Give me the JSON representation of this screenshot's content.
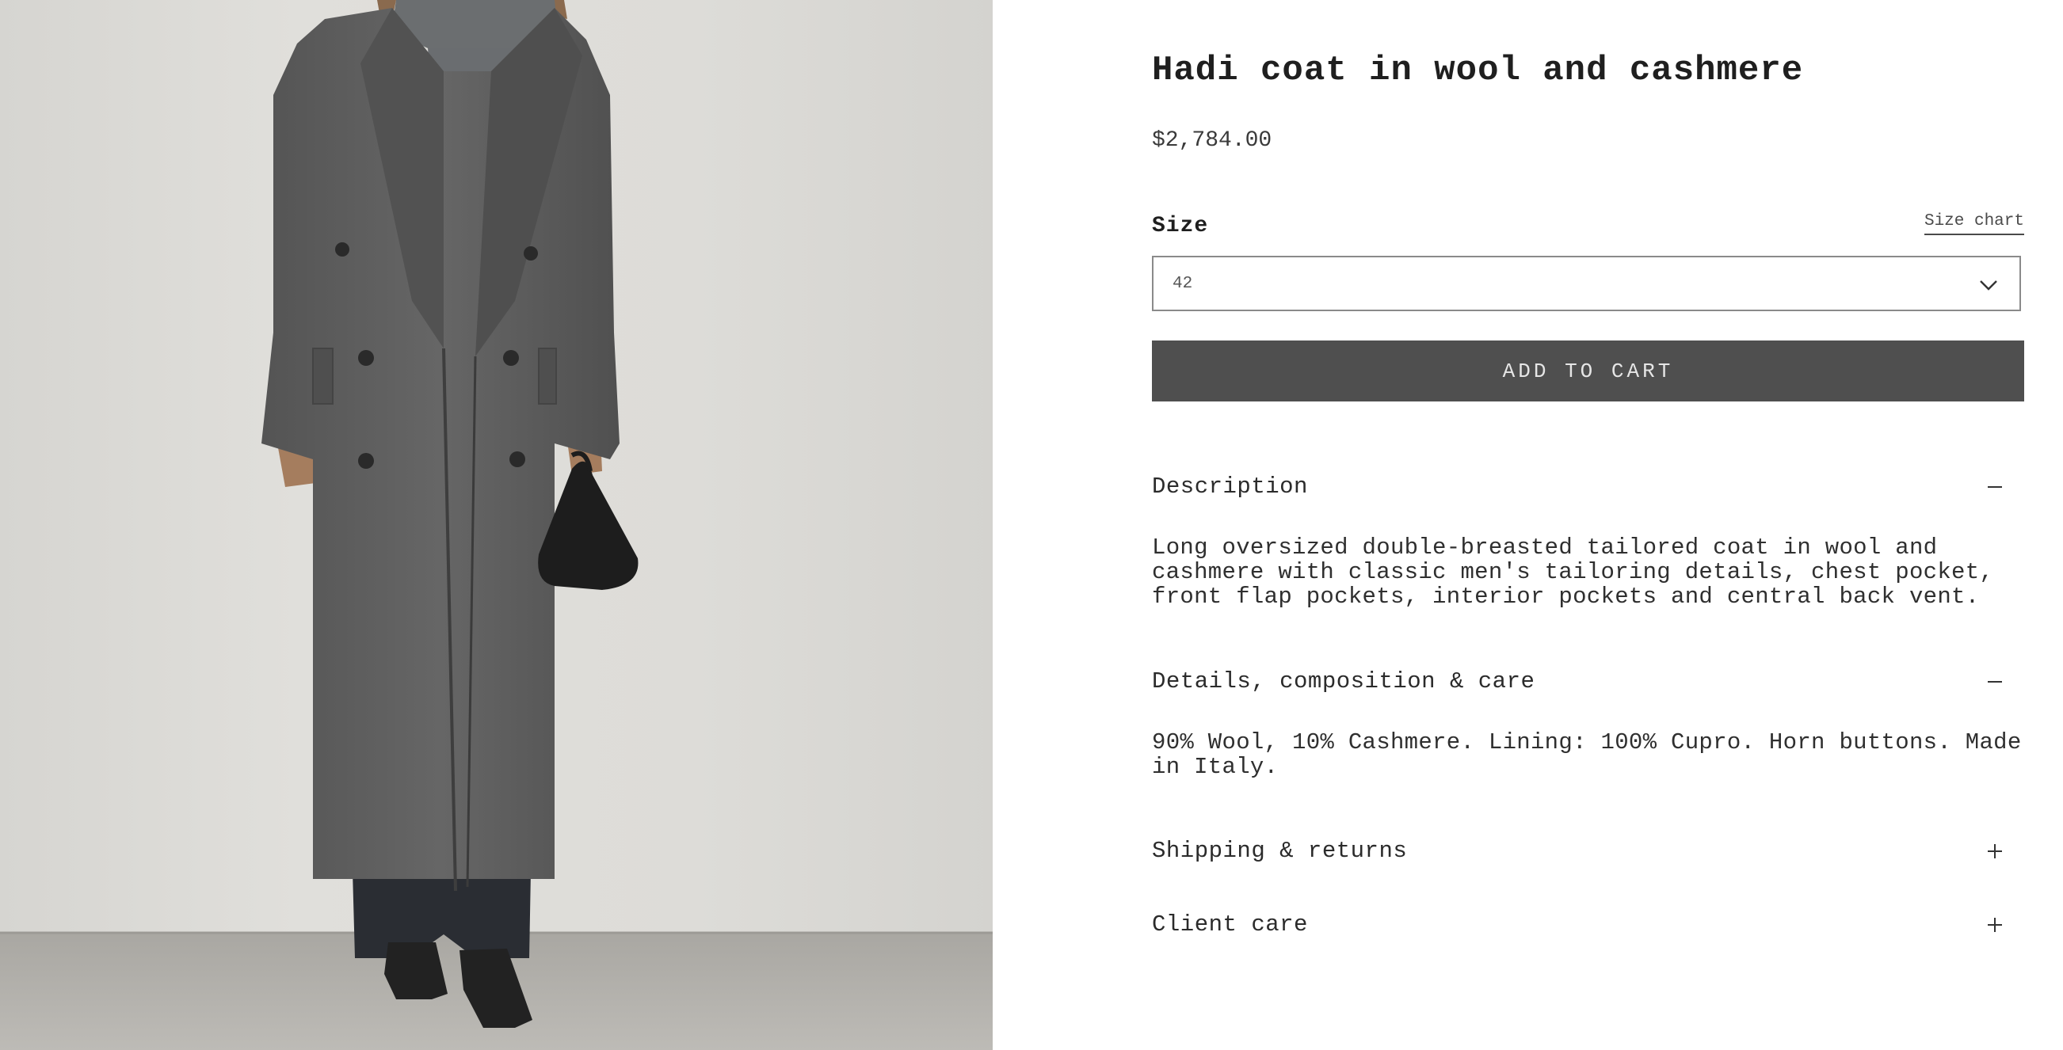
{
  "product": {
    "title": "Hadi coat in wool and cashmere",
    "price": "$2,784.00",
    "image_icon": "product-photo-coat"
  },
  "size": {
    "label": "Size",
    "chart_link": "Size chart",
    "selected": "42",
    "dropdown_icon": "chevron-down-icon"
  },
  "cart": {
    "button_label": "ADD TO CART"
  },
  "accordions": [
    {
      "title": "Description",
      "expanded": true,
      "icon": "minus-icon",
      "body": "Long oversized double-breasted tailored coat in wool and cashmere with classic men's tailoring details, chest pocket, front flap pockets, interior pockets and central back vent."
    },
    {
      "title": "Details, composition & care",
      "expanded": true,
      "icon": "minus-icon",
      "body": "90% Wool, 10% Cashmere. Lining: 100% Cupro. Horn buttons. Made in Italy."
    },
    {
      "title": "Shipping & returns",
      "expanded": false,
      "icon": "plus-icon"
    },
    {
      "title": "Client care",
      "expanded": false,
      "icon": "plus-icon"
    }
  ],
  "colors": {
    "button_bg": "#4f4f4f",
    "button_text": "#e6e6e6",
    "text": "#2b2b2b",
    "coat": "#5e5e5e"
  }
}
